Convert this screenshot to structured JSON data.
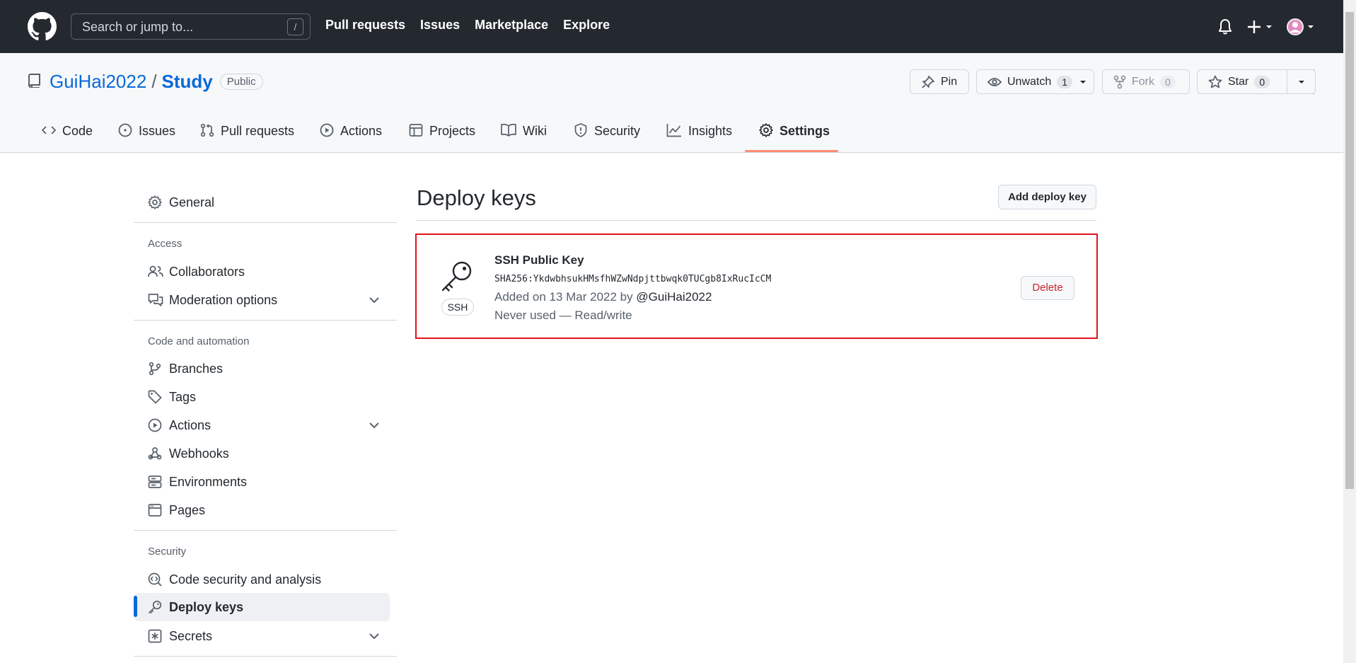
{
  "header": {
    "search_placeholder": "Search or jump to...",
    "slash_key": "/",
    "nav": [
      "Pull requests",
      "Issues",
      "Marketplace",
      "Explore"
    ]
  },
  "repo": {
    "owner": "GuiHai2022",
    "separator": "/",
    "name": "Study",
    "visibility": "Public",
    "pin_label": "Pin",
    "unwatch_label": "Unwatch",
    "unwatch_count": "1",
    "fork_label": "Fork",
    "fork_count": "0",
    "star_label": "Star",
    "star_count": "0"
  },
  "tabs": [
    "Code",
    "Issues",
    "Pull requests",
    "Actions",
    "Projects",
    "Wiki",
    "Security",
    "Insights",
    "Settings"
  ],
  "sidebar": {
    "general": "General",
    "access_heading": "Access",
    "collaborators": "Collaborators",
    "moderation": "Moderation options",
    "code_heading": "Code and automation",
    "branches": "Branches",
    "tags": "Tags",
    "actions": "Actions",
    "webhooks": "Webhooks",
    "environments": "Environments",
    "pages": "Pages",
    "security_heading": "Security",
    "code_security": "Code security and analysis",
    "deploy_keys": "Deploy keys",
    "secrets": "Secrets"
  },
  "main": {
    "title": "Deploy keys",
    "add_button": "Add deploy key",
    "key": {
      "type_badge": "SSH",
      "name": "SSH Public Key",
      "fingerprint": "SHA256:YkdwbhsukHMsfhWZwNdpjttbwqk0TUCgb8IxRucIcCM",
      "added_prefix": "Added on 13 Mar 2022 by",
      "added_by": "@GuiHai2022",
      "usage": "Never used — Read/write",
      "delete_label": "Delete"
    }
  },
  "colors": {
    "header_bg": "#24292f",
    "link": "#0969da",
    "active_tab_underline": "#fd8c73",
    "highlight_box": "#e3121a",
    "danger": "#cf222e"
  }
}
